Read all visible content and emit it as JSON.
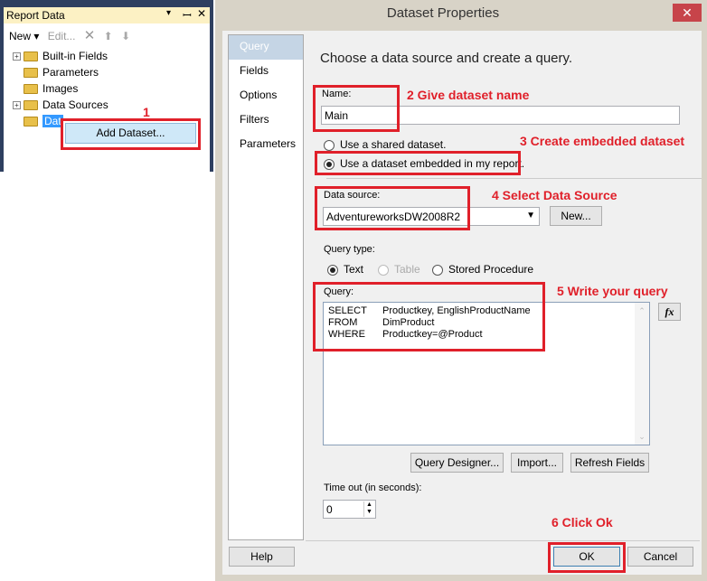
{
  "report_data": {
    "title": "Report Data",
    "toolbar": {
      "new": "New",
      "edit": "Edit..."
    },
    "tree": [
      "Built-in Fields",
      "Parameters",
      "Images",
      "Data Sources",
      "Dat"
    ],
    "context_menu": "Add Dataset..."
  },
  "annotations": {
    "a1": "1",
    "a2": "2 Give dataset name",
    "a3": "3 Create embedded dataset",
    "a4": "4 Select Data Source",
    "a5": "5 Write your query",
    "a6": "6 Click Ok"
  },
  "dialog": {
    "title": "Dataset Properties",
    "close": "✕",
    "nav": [
      "Query",
      "Fields",
      "Options",
      "Filters",
      "Parameters"
    ],
    "heading": "Choose a data source and create a query.",
    "name_label": "Name:",
    "name_value": "Main",
    "radio_shared": "Use a shared dataset.",
    "radio_embedded": "Use a dataset embedded in my report.",
    "datasource_label": "Data source:",
    "datasource_value": "AdventureworksDW2008R2",
    "new_button": "New...",
    "query_type_label": "Query type:",
    "qt_text": "Text",
    "qt_table": "Table",
    "qt_sp": "Stored Procedure",
    "query_label": "Query:",
    "query": [
      [
        "SELECT",
        "Productkey, EnglishProductName"
      ],
      [
        "FROM",
        "DimProduct"
      ],
      [
        "WHERE",
        "Productkey=@Product"
      ]
    ],
    "fx": "fx",
    "query_designer": "Query Designer...",
    "import": "Import...",
    "refresh": "Refresh Fields",
    "timeout_label": "Time out (in seconds):",
    "timeout_value": "0",
    "help": "Help",
    "ok": "OK",
    "cancel": "Cancel"
  }
}
